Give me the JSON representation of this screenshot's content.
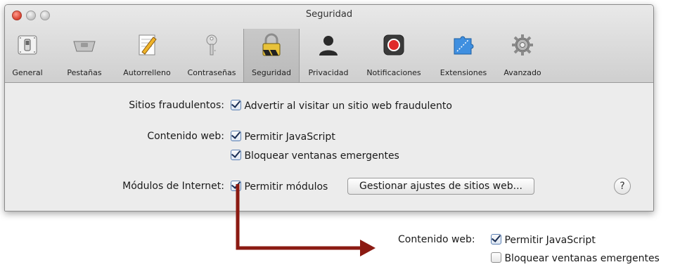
{
  "window": {
    "title": "Seguridad"
  },
  "toolbar": {
    "items": [
      {
        "label": "General",
        "icon": "general-switch-icon"
      },
      {
        "label": "Pestañas",
        "icon": "tabs-icon"
      },
      {
        "label": "Autorrelleno",
        "icon": "autofill-pencil-icon"
      },
      {
        "label": "Contraseñas",
        "icon": "key-icon"
      },
      {
        "label": "Seguridad",
        "icon": "lock-icon",
        "selected": true
      },
      {
        "label": "Privacidad",
        "icon": "person-silhouette-icon"
      },
      {
        "label": "Notificaciones",
        "icon": "notification-record-icon"
      },
      {
        "label": "Extensiones",
        "icon": "puzzle-piece-icon"
      },
      {
        "label": "Avanzado",
        "icon": "gear-icon"
      }
    ]
  },
  "security": {
    "fraud_label": "Sitios fraudulentos:",
    "fraud_warn": "Advertir al visitar un sitio web fraudulento",
    "web_content_label": "Contenido web:",
    "allow_js": "Permitir JavaScript",
    "block_popups": "Bloquear ventanas emergentes",
    "plugins_label": "Módulos de Internet:",
    "allow_plugins": "Permitir módulos",
    "manage_button": "Gestionar ajustes de sitios web...",
    "help": "?"
  },
  "callout": {
    "web_content_label": "Contenido web:",
    "allow_js": "Permitir JavaScript",
    "block_popups": "Bloquear ventanas emergentes"
  },
  "colors": {
    "arrow": "#8b1a12",
    "checkbox_border": "#5a7fb3",
    "window_bg": "#ececec"
  }
}
